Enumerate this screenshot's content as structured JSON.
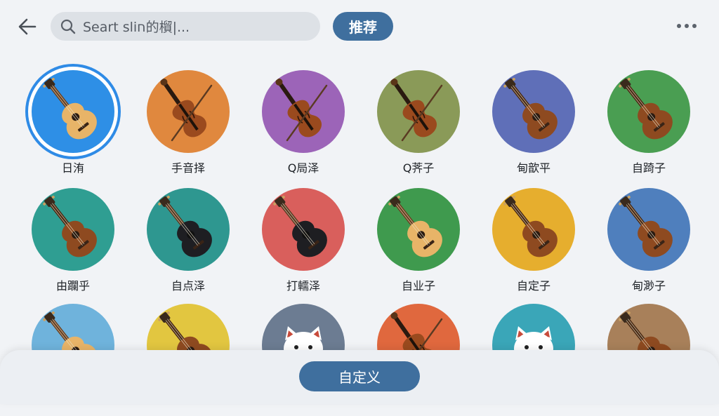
{
  "header": {
    "back_icon": "arrow-left-icon",
    "search_placeholder": "Seart sliח的橮|...",
    "recommend_label": "推荐",
    "more_icon": "more-horizontal-icon"
  },
  "presets": [
    {
      "label": "日洧",
      "bg": "#2e8fe6",
      "instrument": "acoustic-guitar-icon",
      "selected": true
    },
    {
      "label": "手音择",
      "bg": "#e0883e",
      "instrument": "violin-icon",
      "selected": false
    },
    {
      "label": "Q局泽",
      "bg": "#9c64b8",
      "instrument": "violin-icon",
      "selected": false
    },
    {
      "label": "Q荠子",
      "bg": "#8a9a58",
      "instrument": "violin-icon",
      "selected": false
    },
    {
      "label": "甸歆平",
      "bg": "#5f6fb8",
      "instrument": "ukulele-icon",
      "selected": false
    },
    {
      "label": "自踦子",
      "bg": "#4a9e52",
      "instrument": "ukulele-icon",
      "selected": false
    },
    {
      "label": "由躝乎",
      "bg": "#2f9e92",
      "instrument": "ukulele-icon",
      "selected": false
    },
    {
      "label": "自点泽",
      "bg": "#2e9790",
      "instrument": "black-ukulele-icon",
      "selected": false
    },
    {
      "label": "打轜泽",
      "bg": "#d95f5c",
      "instrument": "black-ukulele-icon",
      "selected": false
    },
    {
      "label": "自业子",
      "bg": "#3f9a4e",
      "instrument": "acoustic-guitar-icon",
      "selected": false
    },
    {
      "label": "自定子",
      "bg": "#e6ae2e",
      "instrument": "ukulele-icon",
      "selected": false
    },
    {
      "label": "甸渺子",
      "bg": "#4f7fbd",
      "instrument": "ukulele-icon",
      "selected": false
    },
    {
      "label": "",
      "bg": "#6fb3dc",
      "instrument": "acoustic-guitar-icon",
      "selected": false
    },
    {
      "label": "",
      "bg": "#e2c640",
      "instrument": "ukulele-icon",
      "selected": false
    },
    {
      "label": "",
      "bg": "#6c7c92",
      "instrument": "lucky-cat-icon",
      "selected": false
    },
    {
      "label": "",
      "bg": "#e0683e",
      "instrument": "violin-icon",
      "selected": false
    },
    {
      "label": "",
      "bg": "#3aa6b8",
      "instrument": "lucky-cat-icon",
      "selected": false
    },
    {
      "label": "",
      "bg": "#a8805a",
      "instrument": "ukulele-icon",
      "selected": false
    }
  ],
  "footer": {
    "custom_label": "自定义"
  }
}
